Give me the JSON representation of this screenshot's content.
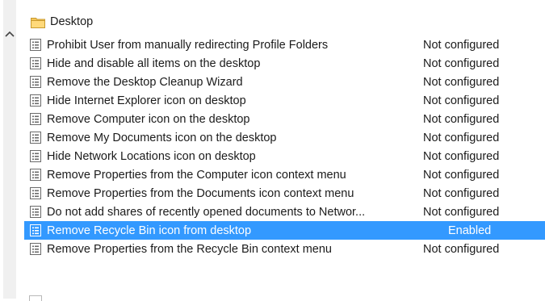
{
  "folder": {
    "label": "Desktop",
    "icon": "folder-icon"
  },
  "policies": [
    {
      "name": "Prohibit User from manually redirecting Profile Folders",
      "state": "Not configured",
      "selected": false
    },
    {
      "name": "Hide and disable all items on the desktop",
      "state": "Not configured",
      "selected": false
    },
    {
      "name": "Remove the Desktop Cleanup Wizard",
      "state": "Not configured",
      "selected": false
    },
    {
      "name": "Hide Internet Explorer icon on desktop",
      "state": "Not configured",
      "selected": false
    },
    {
      "name": "Remove Computer icon on the desktop",
      "state": "Not configured",
      "selected": false
    },
    {
      "name": "Remove My Documents icon on the desktop",
      "state": "Not configured",
      "selected": false
    },
    {
      "name": "Hide Network Locations icon on desktop",
      "state": "Not configured",
      "selected": false
    },
    {
      "name": "Remove Properties from the Computer icon context menu",
      "state": "Not configured",
      "selected": false
    },
    {
      "name": "Remove Properties from the Documents icon context menu",
      "state": "Not configured",
      "selected": false
    },
    {
      "name": "Do not add shares of recently opened documents to Networ...",
      "state": "Not configured",
      "selected": false
    },
    {
      "name": "Remove Recycle Bin icon from desktop",
      "state": "Enabled",
      "selected": true
    },
    {
      "name": "Remove Properties from the Recycle Bin context menu",
      "state": "Not configured",
      "selected": false
    }
  ],
  "colors": {
    "selection": "#3399ff",
    "folder": "#f3c55a",
    "scroll_track": "#f0f0f0"
  }
}
